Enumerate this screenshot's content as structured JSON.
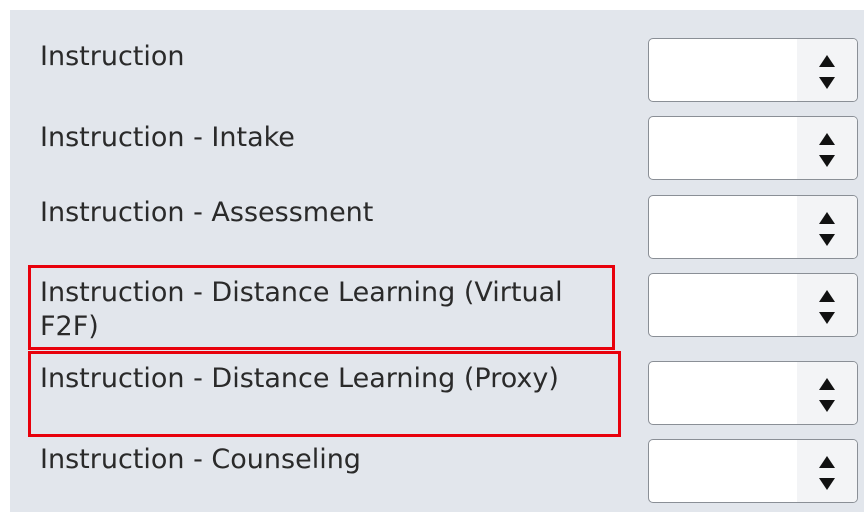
{
  "rows": [
    {
      "label": "Instruction",
      "value": ""
    },
    {
      "label": "Instruction - Intake",
      "value": ""
    },
    {
      "label": "Instruction - Assessment",
      "value": ""
    },
    {
      "label": "Instruction - Distance Learning (Virtual",
      "label_line2": "F2F)",
      "value": ""
    },
    {
      "label": "Instruction - Distance Learning (Proxy)",
      "value": ""
    },
    {
      "label": "Instruction - Counseling",
      "value": ""
    }
  ],
  "icons": {
    "up": "triangle-up-icon",
    "down": "triangle-down-icon"
  },
  "colors": {
    "panel_background": "#e2e6ec",
    "highlight": "#e8000b"
  }
}
